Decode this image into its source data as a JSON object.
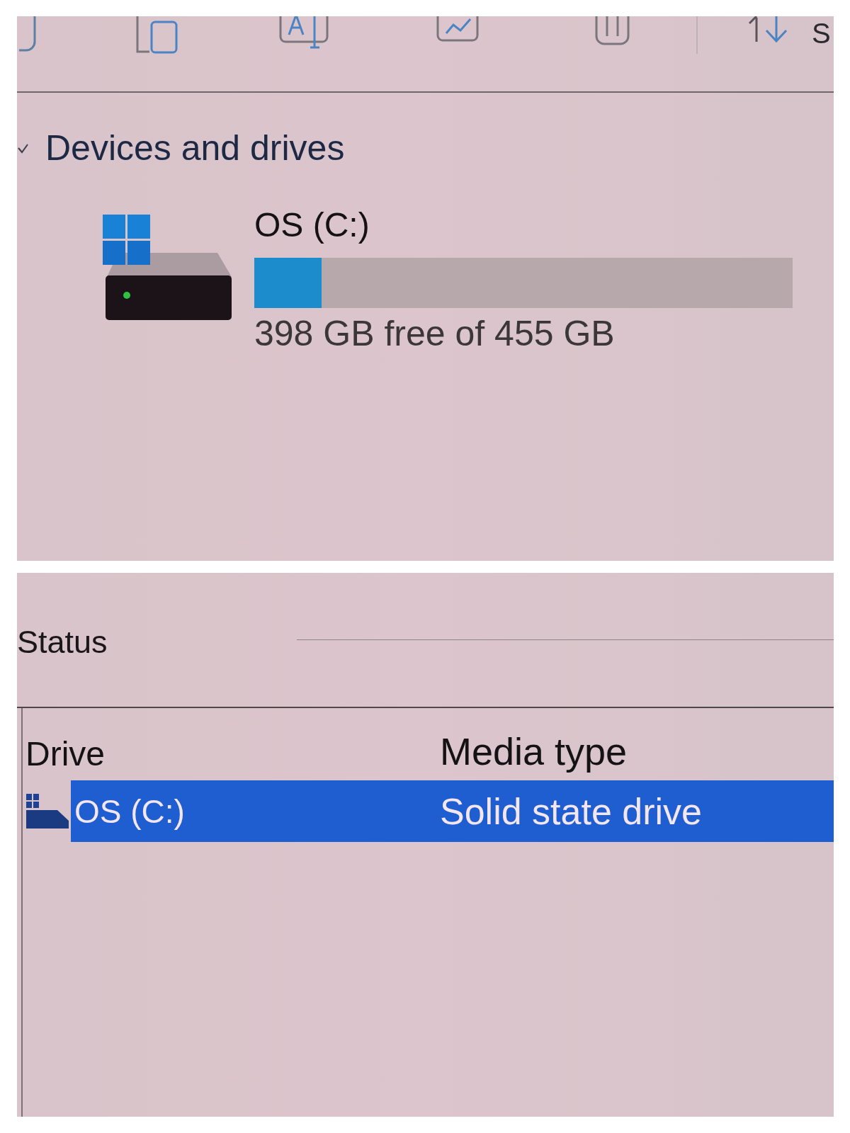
{
  "toolbar": {
    "label": "S"
  },
  "devices_section": {
    "title": "Devices and drives",
    "expanded": true,
    "drives": [
      {
        "name": "OS (C:)",
        "level": 0.125,
        "detail": "398 GB free of 455 GB"
      }
    ]
  },
  "status_panel": {
    "title": "Status",
    "table": {
      "columns": [
        "Drive",
        "Media type"
      ],
      "rows": [
        {
          "cells": [
            "OS (C:)",
            "Solid state drive"
          ],
          "selected": true
        }
      ]
    }
  }
}
